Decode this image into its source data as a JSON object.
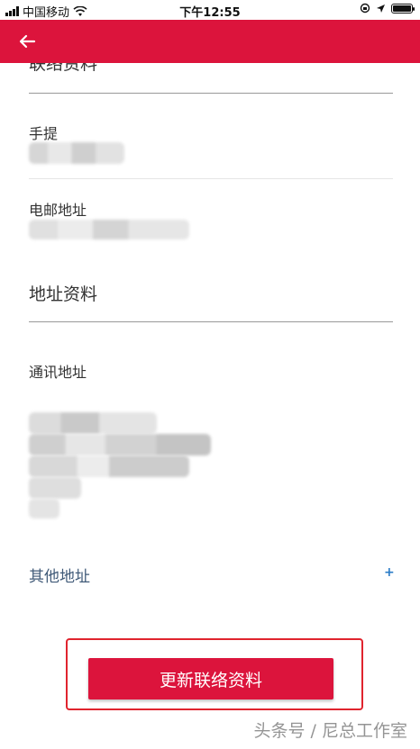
{
  "status_bar": {
    "carrier": "中国移动",
    "time": "下午12:55"
  },
  "app_bar": {
    "back_icon": "arrow-left-icon",
    "color": "#dc143c"
  },
  "contact_section": {
    "title": "联络资料",
    "mobile_label": "手提",
    "email_label": "电邮地址"
  },
  "address_section": {
    "title": "地址资料",
    "mailing_label": "通讯地址",
    "other_label": "其他地址",
    "add_symbol": "+"
  },
  "actions": {
    "update_label": "更新联络资料"
  },
  "watermark": "头条号 / 尼总工作室"
}
